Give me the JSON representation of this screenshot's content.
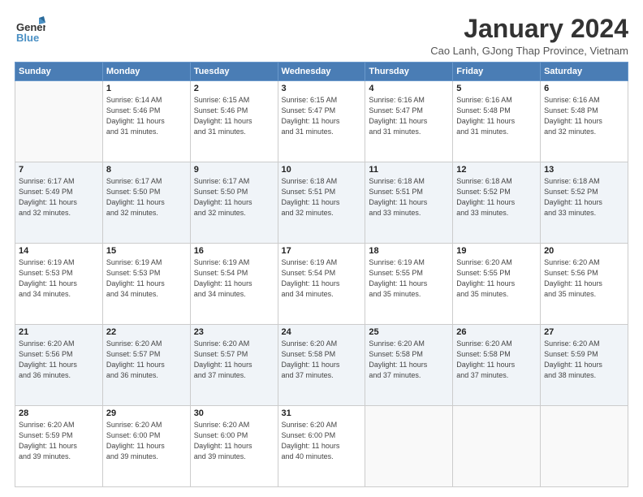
{
  "logo": {
    "line1": "General",
    "line2": "Blue"
  },
  "title": "January 2024",
  "subtitle": "Cao Lanh, GJong Thap Province, Vietnam",
  "headers": [
    "Sunday",
    "Monday",
    "Tuesday",
    "Wednesday",
    "Thursday",
    "Friday",
    "Saturday"
  ],
  "weeks": [
    [
      {
        "day": "",
        "info": ""
      },
      {
        "day": "1",
        "info": "Sunrise: 6:14 AM\nSunset: 5:46 PM\nDaylight: 11 hours\nand 31 minutes."
      },
      {
        "day": "2",
        "info": "Sunrise: 6:15 AM\nSunset: 5:46 PM\nDaylight: 11 hours\nand 31 minutes."
      },
      {
        "day": "3",
        "info": "Sunrise: 6:15 AM\nSunset: 5:47 PM\nDaylight: 11 hours\nand 31 minutes."
      },
      {
        "day": "4",
        "info": "Sunrise: 6:16 AM\nSunset: 5:47 PM\nDaylight: 11 hours\nand 31 minutes."
      },
      {
        "day": "5",
        "info": "Sunrise: 6:16 AM\nSunset: 5:48 PM\nDaylight: 11 hours\nand 31 minutes."
      },
      {
        "day": "6",
        "info": "Sunrise: 6:16 AM\nSunset: 5:48 PM\nDaylight: 11 hours\nand 32 minutes."
      }
    ],
    [
      {
        "day": "7",
        "info": "Sunrise: 6:17 AM\nSunset: 5:49 PM\nDaylight: 11 hours\nand 32 minutes."
      },
      {
        "day": "8",
        "info": "Sunrise: 6:17 AM\nSunset: 5:50 PM\nDaylight: 11 hours\nand 32 minutes."
      },
      {
        "day": "9",
        "info": "Sunrise: 6:17 AM\nSunset: 5:50 PM\nDaylight: 11 hours\nand 32 minutes."
      },
      {
        "day": "10",
        "info": "Sunrise: 6:18 AM\nSunset: 5:51 PM\nDaylight: 11 hours\nand 32 minutes."
      },
      {
        "day": "11",
        "info": "Sunrise: 6:18 AM\nSunset: 5:51 PM\nDaylight: 11 hours\nand 33 minutes."
      },
      {
        "day": "12",
        "info": "Sunrise: 6:18 AM\nSunset: 5:52 PM\nDaylight: 11 hours\nand 33 minutes."
      },
      {
        "day": "13",
        "info": "Sunrise: 6:18 AM\nSunset: 5:52 PM\nDaylight: 11 hours\nand 33 minutes."
      }
    ],
    [
      {
        "day": "14",
        "info": "Sunrise: 6:19 AM\nSunset: 5:53 PM\nDaylight: 11 hours\nand 34 minutes."
      },
      {
        "day": "15",
        "info": "Sunrise: 6:19 AM\nSunset: 5:53 PM\nDaylight: 11 hours\nand 34 minutes."
      },
      {
        "day": "16",
        "info": "Sunrise: 6:19 AM\nSunset: 5:54 PM\nDaylight: 11 hours\nand 34 minutes."
      },
      {
        "day": "17",
        "info": "Sunrise: 6:19 AM\nSunset: 5:54 PM\nDaylight: 11 hours\nand 34 minutes."
      },
      {
        "day": "18",
        "info": "Sunrise: 6:19 AM\nSunset: 5:55 PM\nDaylight: 11 hours\nand 35 minutes."
      },
      {
        "day": "19",
        "info": "Sunrise: 6:20 AM\nSunset: 5:55 PM\nDaylight: 11 hours\nand 35 minutes."
      },
      {
        "day": "20",
        "info": "Sunrise: 6:20 AM\nSunset: 5:56 PM\nDaylight: 11 hours\nand 35 minutes."
      }
    ],
    [
      {
        "day": "21",
        "info": "Sunrise: 6:20 AM\nSunset: 5:56 PM\nDaylight: 11 hours\nand 36 minutes."
      },
      {
        "day": "22",
        "info": "Sunrise: 6:20 AM\nSunset: 5:57 PM\nDaylight: 11 hours\nand 36 minutes."
      },
      {
        "day": "23",
        "info": "Sunrise: 6:20 AM\nSunset: 5:57 PM\nDaylight: 11 hours\nand 37 minutes."
      },
      {
        "day": "24",
        "info": "Sunrise: 6:20 AM\nSunset: 5:58 PM\nDaylight: 11 hours\nand 37 minutes."
      },
      {
        "day": "25",
        "info": "Sunrise: 6:20 AM\nSunset: 5:58 PM\nDaylight: 11 hours\nand 37 minutes."
      },
      {
        "day": "26",
        "info": "Sunrise: 6:20 AM\nSunset: 5:58 PM\nDaylight: 11 hours\nand 37 minutes."
      },
      {
        "day": "27",
        "info": "Sunrise: 6:20 AM\nSunset: 5:59 PM\nDaylight: 11 hours\nand 38 minutes."
      }
    ],
    [
      {
        "day": "28",
        "info": "Sunrise: 6:20 AM\nSunset: 5:59 PM\nDaylight: 11 hours\nand 39 minutes."
      },
      {
        "day": "29",
        "info": "Sunrise: 6:20 AM\nSunset: 6:00 PM\nDaylight: 11 hours\nand 39 minutes."
      },
      {
        "day": "30",
        "info": "Sunrise: 6:20 AM\nSunset: 6:00 PM\nDaylight: 11 hours\nand 39 minutes."
      },
      {
        "day": "31",
        "info": "Sunrise: 6:20 AM\nSunset: 6:00 PM\nDaylight: 11 hours\nand 40 minutes."
      },
      {
        "day": "",
        "info": ""
      },
      {
        "day": "",
        "info": ""
      },
      {
        "day": "",
        "info": ""
      }
    ]
  ]
}
